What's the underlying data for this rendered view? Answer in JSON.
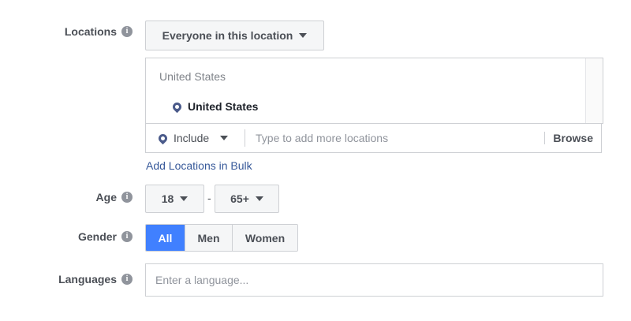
{
  "locations": {
    "label": "Locations",
    "mode_dropdown": "Everyone in this location",
    "header": "United States",
    "selected": [
      "United States"
    ],
    "include_label": "Include",
    "input_placeholder": "Type to add more locations",
    "browse_label": "Browse",
    "bulk_link": "Add Locations in Bulk"
  },
  "age": {
    "label": "Age",
    "min": "18",
    "separator": "-",
    "max": "65+"
  },
  "gender": {
    "label": "Gender",
    "options": [
      "All",
      "Men",
      "Women"
    ],
    "selected": "All"
  },
  "languages": {
    "label": "Languages",
    "placeholder": "Enter a language..."
  },
  "colors": {
    "accent": "#4080ff",
    "link": "#365899",
    "pin": "#4a5a8a"
  }
}
